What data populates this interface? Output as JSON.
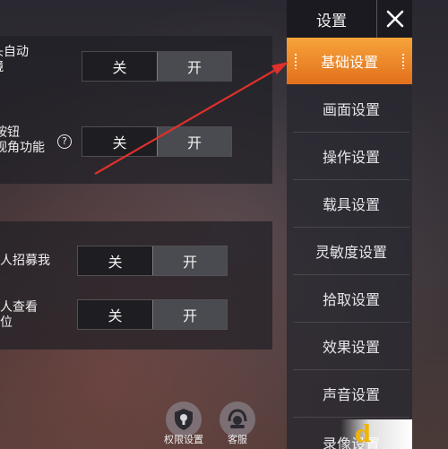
{
  "settings": {
    "row1": {
      "label": "探头自动\n开镜",
      "off": "关",
      "on": "开"
    },
    "row2": {
      "label": "按钮\n视角功能",
      "off": "关",
      "on": "开",
      "help": "?"
    },
    "row3": {
      "label": "他人招募我",
      "off": "关",
      "on": "开"
    },
    "row4": {
      "label": "他人查看\n定位",
      "off": "关",
      "on": "开"
    }
  },
  "sidebar": {
    "title": "设置",
    "close": "✕",
    "items": [
      {
        "label": "基础设置",
        "active": true
      },
      {
        "label": "画面设置"
      },
      {
        "label": "操作设置"
      },
      {
        "label": "载具设置"
      },
      {
        "label": "灵敏度设置"
      },
      {
        "label": "拾取设置"
      },
      {
        "label": "效果设置"
      },
      {
        "label": "声音设置"
      },
      {
        "label": "录像设置"
      }
    ]
  },
  "bottom": {
    "permissions": "权限设置",
    "service": "客服"
  },
  "colors": {
    "accent": "#f08a28",
    "arrow": "#e0302a"
  }
}
